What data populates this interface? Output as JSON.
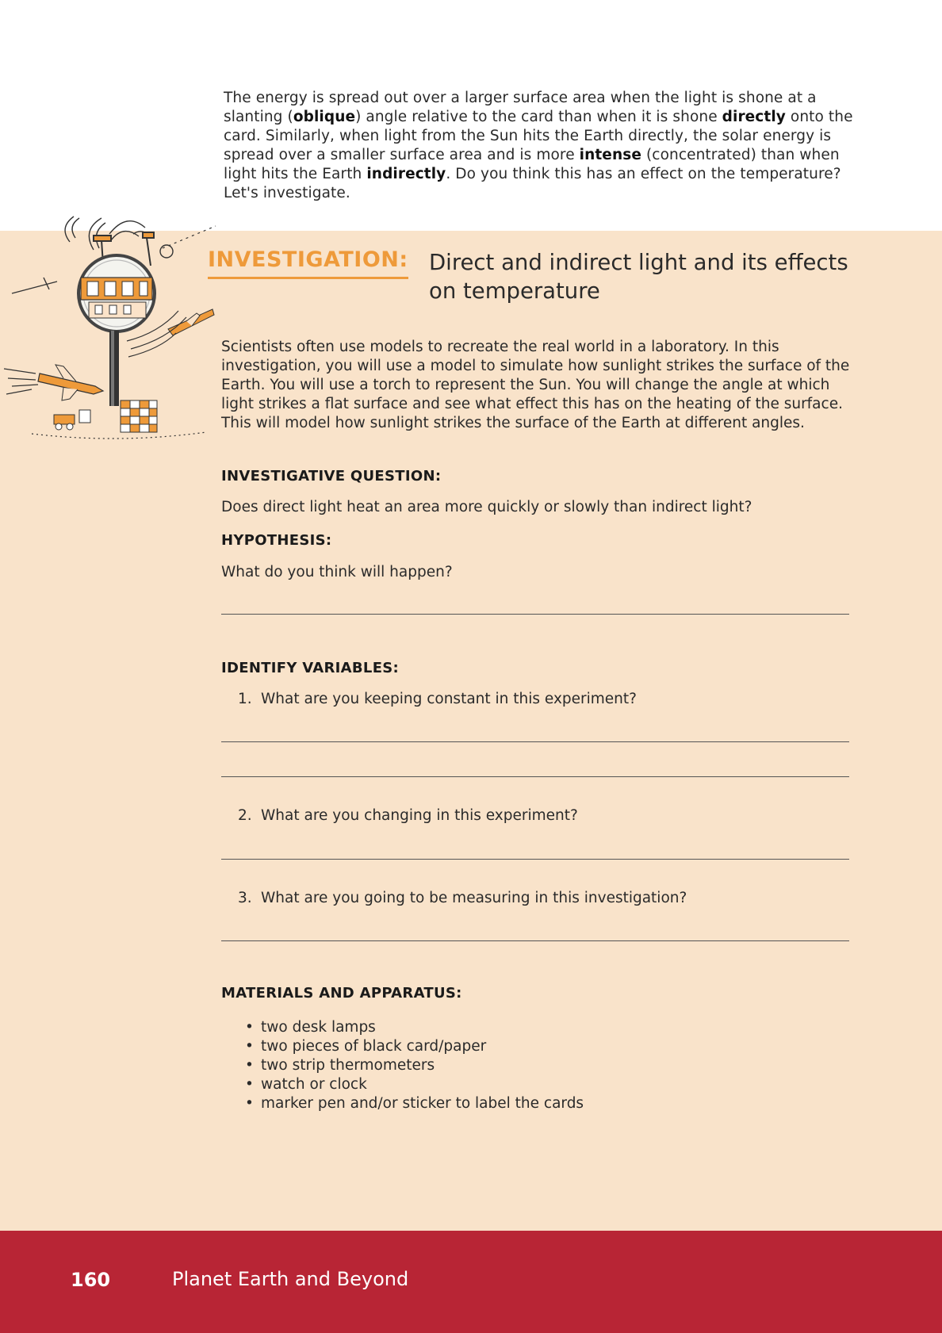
{
  "intro": {
    "segments": [
      {
        "text": "The energy is spread out over a larger surface area when the light is shone at a slanting (",
        "bold": false
      },
      {
        "text": "oblique",
        "bold": true
      },
      {
        "text": ") angle relative to the card than when it is shone ",
        "bold": false
      },
      {
        "text": "directly",
        "bold": true
      },
      {
        "text": " onto the card. Similarly, when light from the Sun hits the Earth directly, the solar energy is spread over a smaller surface area and is more ",
        "bold": false
      },
      {
        "text": "intense",
        "bold": true
      },
      {
        "text": " (concentrated) than when light hits the Earth ",
        "bold": false
      },
      {
        "text": "indirectly",
        "bold": true
      },
      {
        "text": ". Do you think this has an effect on the temperature? Let's investigate.",
        "bold": false
      }
    ]
  },
  "investigation": {
    "label": "INVESTIGATION:",
    "title": "Direct and indirect light and its effects on temperature",
    "description": "Scientists often use models to recreate the real world in a laboratory. In this investigation, you will use a model to simulate how sunlight strikes the surface of the Earth. You will use a torch to represent the Sun. You will change the angle at which light strikes a flat surface and see what effect this has on the heating of the surface. This will model how sunlight strikes the surface of the Earth at different angles."
  },
  "question": {
    "heading": "INVESTIGATIVE QUESTION:",
    "text": "Does direct light heat an area more quickly or slowly than indirect light?"
  },
  "hypothesis": {
    "heading": "HYPOTHESIS:",
    "text": "What do you think will happen?"
  },
  "variables": {
    "heading": "IDENTIFY VARIABLES:",
    "items": [
      {
        "num": "1.",
        "text": "What are you keeping constant in this experiment?"
      },
      {
        "num": "2.",
        "text": "What are you changing in this experiment?"
      },
      {
        "num": "3.",
        "text": "What are you going to be measuring in this investigation?"
      }
    ]
  },
  "materials": {
    "heading": "MATERIALS AND APPARATUS:",
    "items": [
      "two desk lamps",
      "two pieces of black card/paper",
      "two strip thermometers",
      "watch or clock",
      "marker pen and/or sticker to label the cards"
    ]
  },
  "footer": {
    "page_number": "160",
    "book_title": "Planet Earth and Beyond"
  },
  "colors": {
    "panel": "#f9e3ca",
    "accent_orange": "#ee9a3a",
    "footer_red": "#b82535"
  }
}
